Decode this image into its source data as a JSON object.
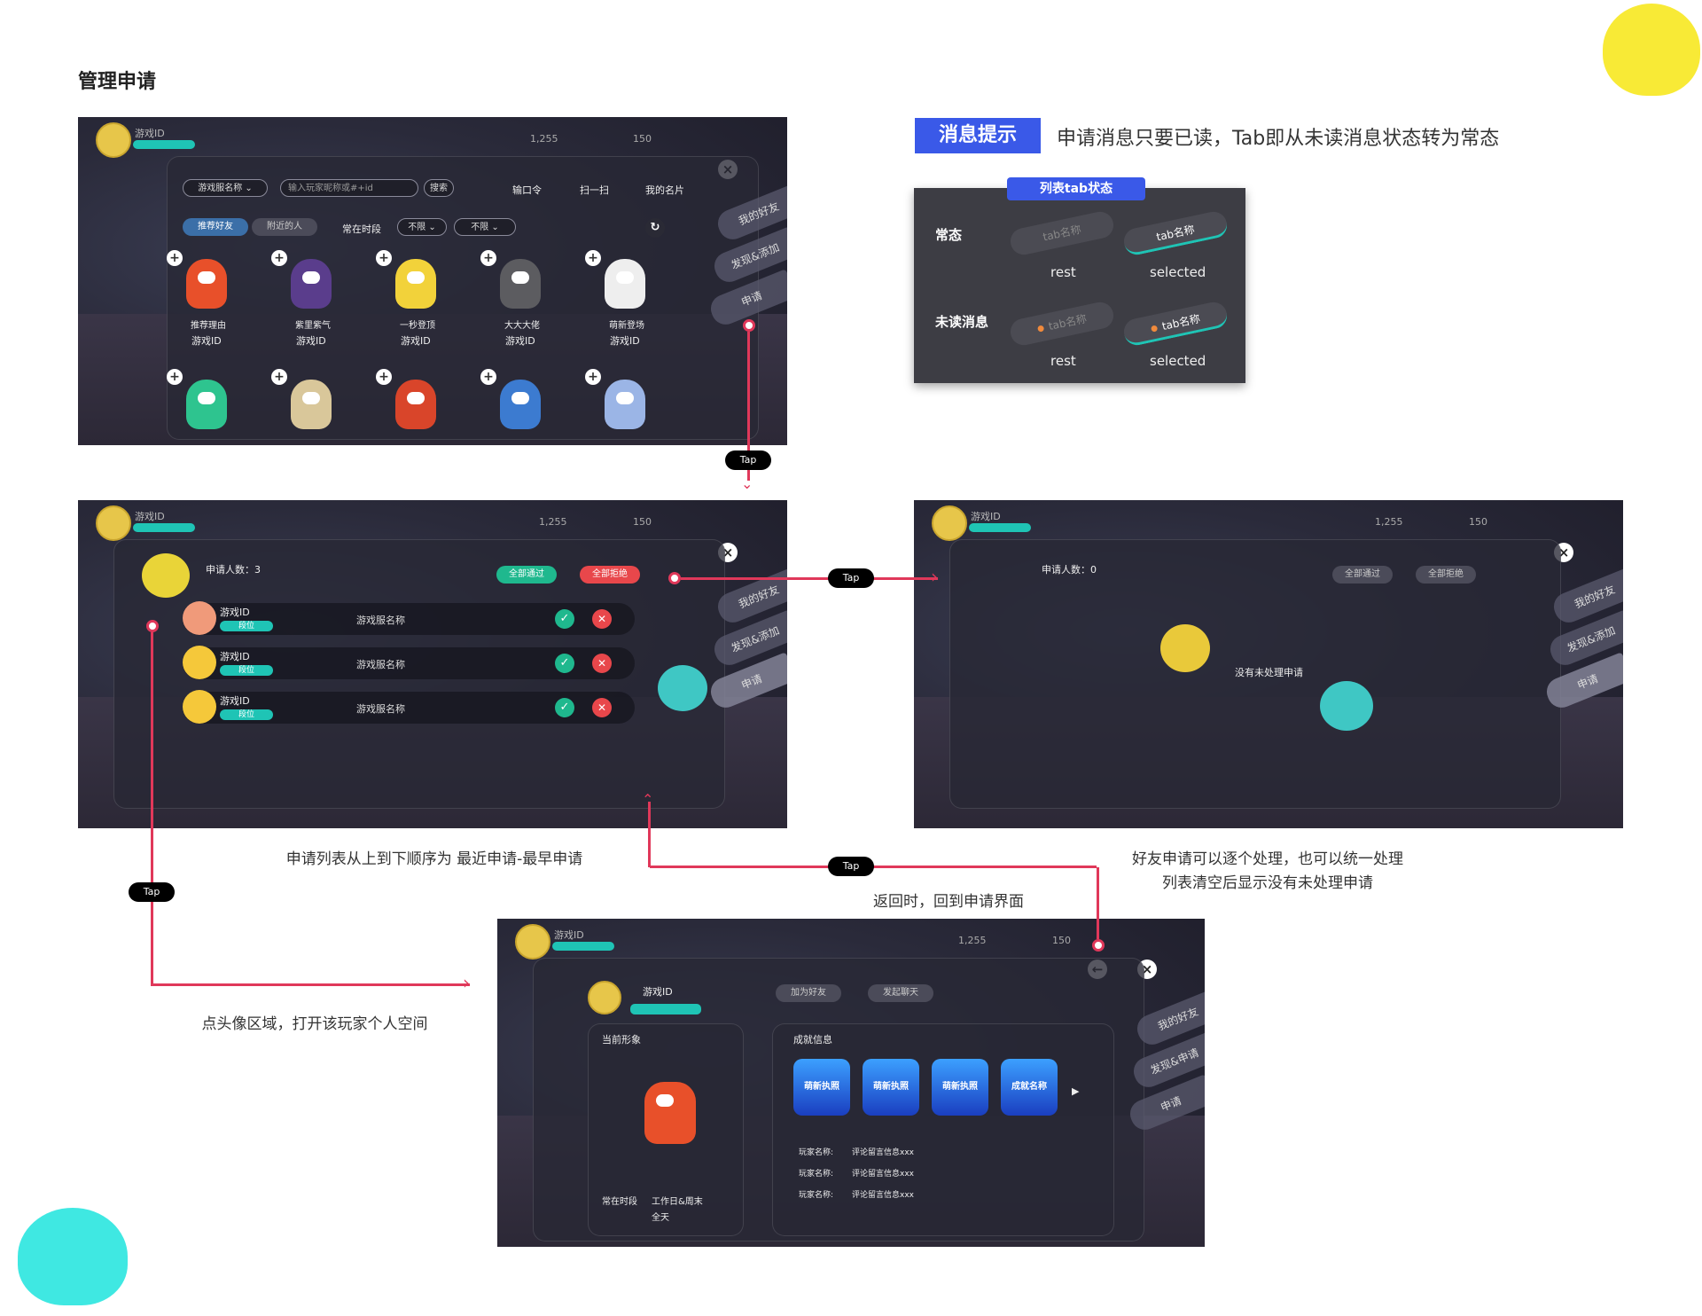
{
  "page_title": "管理申请",
  "tip": {
    "tag": "消息提示",
    "text": "申请消息只要已读，Tab即从未读消息状态转为常态"
  },
  "tab_states": {
    "header": "列表tab状态",
    "row_normal": "常态",
    "row_unread": "未读消息",
    "chip_label": "tab名称",
    "rest": "rest",
    "selected": "selected"
  },
  "tap_label": "Tap",
  "screen1": {
    "server_select": "游戏服名称",
    "search_placeholder": "输入玩家昵称或#+id",
    "search_button": "搜索",
    "code_label": "输口令",
    "scan_label": "扫一扫",
    "card_label": "我的名片",
    "tab_recommend": "推荐好友",
    "tab_nearby": "附近的人",
    "time_label": "常在时段",
    "filter1": "不限",
    "filter2": "不限",
    "side_tabs": [
      "我的好友",
      "发现&添加",
      "申请"
    ],
    "cards": [
      {
        "caption": "推荐理由",
        "id": "游戏ID",
        "color": "#e8502a"
      },
      {
        "caption": "紫里紫气",
        "id": "游戏ID",
        "color": "#5a3d8c"
      },
      {
        "caption": "一秒登顶",
        "id": "游戏ID",
        "color": "#f2d23a"
      },
      {
        "caption": "大大大佬",
        "id": "游戏ID",
        "color": "#5c5c60"
      },
      {
        "caption": "萌新登场",
        "id": "游戏ID",
        "color": "#eeeeee"
      }
    ],
    "cards_row2_colors": [
      "#2ec48f",
      "#d9c79a",
      "#d9452a",
      "#3c7bd0",
      "#9bb5e6"
    ]
  },
  "hud": {
    "player_id": "游戏ID",
    "rank": "段位",
    "res1": "1,255",
    "res2": "150"
  },
  "screen2": {
    "count_label": "申请人数：3",
    "accept_all": "全部通过",
    "reject_all": "全部拒绝",
    "rows": [
      {
        "id": "游戏ID",
        "rank": "段位",
        "server": "游戏服名称"
      },
      {
        "id": "游戏ID",
        "rank": "段位",
        "server": "游戏服名称"
      },
      {
        "id": "游戏ID",
        "rank": "段位",
        "server": "游戏服名称"
      }
    ],
    "side_tabs": [
      "我的好友",
      "发现&添加",
      "申请"
    ]
  },
  "screen3": {
    "count_label": "申请人数：0",
    "accept_all": "全部通过",
    "reject_all": "全部拒绝",
    "empty_text": "没有未处理申请",
    "side_tabs": [
      "我的好友",
      "发现&添加",
      "申请"
    ]
  },
  "screen4": {
    "player_id": "游戏ID",
    "rank": "段位",
    "add_friend": "加为好友",
    "start_chat": "发起聊天",
    "current_look": "当前形象",
    "achievements": "成就信息",
    "time_label": "常在时段",
    "time_value": "工作日&周末",
    "time_value2": "全天",
    "badges": [
      "萌新执照",
      "萌新执照",
      "萌新执照",
      "成就名称"
    ],
    "comments": [
      {
        "name": "玩家名称:",
        "text": "评论留言信息xxx"
      },
      {
        "name": "玩家名称:",
        "text": "评论留言信息xxx"
      },
      {
        "name": "玩家名称:",
        "text": "评论留言信息xxx"
      }
    ],
    "side_tabs": [
      "我的好友",
      "发现&申请",
      "申请"
    ]
  },
  "notes": {
    "list_order": "申请列表从上到下顺序为 最近申请-最早申请",
    "handle_line1": "好友申请可以逐个处理，也可以统一处理",
    "handle_line2": "列表清空后显示没有未处理申请",
    "return": "返回时，回到申请界面",
    "avatar": "点头像区域，打开该玩家个人空间"
  },
  "colors": {
    "accent": "#3a59e8",
    "flow": "#e0385a",
    "teal": "#1fc4b5"
  }
}
